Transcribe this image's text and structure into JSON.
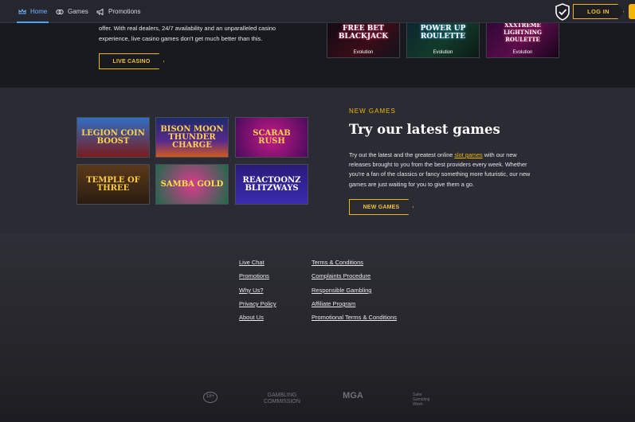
{
  "nav": {
    "items": [
      {
        "label": "Home",
        "icon": "crown-icon"
      },
      {
        "label": "Games",
        "icon": "games-icon"
      },
      {
        "label": "Promotions",
        "icon": "megaphone-icon"
      }
    ],
    "login_label": "LOG IN"
  },
  "live_casino": {
    "text": "offer. With real dealers, 24/7 availability and an unparalleled casino experience, live casino games don't get much better than this.",
    "button_label": "LIVE CASINO",
    "games": [
      {
        "title": "FREE BET BLACKJACK",
        "provider": "Evolution"
      },
      {
        "title": "POWER UP ROULETTE",
        "provider": "Evolution"
      },
      {
        "title": "XXXTREME LIGHTNING ROULETTE",
        "provider": "Evolution"
      }
    ]
  },
  "new_games": {
    "kicker": "NEW GAMES",
    "headline": "Try our latest games",
    "body_before": "Try out the latest and the greatest online ",
    "body_link": "slot games",
    "body_after": " with our new releases brought to you from the best providers every week. Whether you're a fan of the classics or fancy something more futuristic, our new games are just waiting for you to give them a go.",
    "button_label": "NEW GAMES",
    "games": [
      {
        "title": "LEGION COIN BOOST"
      },
      {
        "title": "BISON MOON THUNDER CHARGE"
      },
      {
        "title": "SCARAB RUSH"
      },
      {
        "title": "TEMPLE OF THREE"
      },
      {
        "title": "SAMBA GOLD"
      },
      {
        "title": "REACTOONZ BLITZWAYS"
      }
    ]
  },
  "footer": {
    "col1": [
      "Live Chat",
      "Promotions",
      "Why Us?",
      "Privacy Policy",
      "About Us"
    ],
    "col2": [
      "Terms & Conditions",
      "Complaints Procedure",
      "Responsible Gambling",
      "Affiliate Program",
      "Promotional Terms & Conditions"
    ],
    "logos": [
      "18+",
      "GAMBLING COMMISSION",
      "MGA",
      "Safer Gambling Week"
    ]
  },
  "colors": {
    "accent": "#f2b705",
    "nav_active": "#4da3ff"
  }
}
